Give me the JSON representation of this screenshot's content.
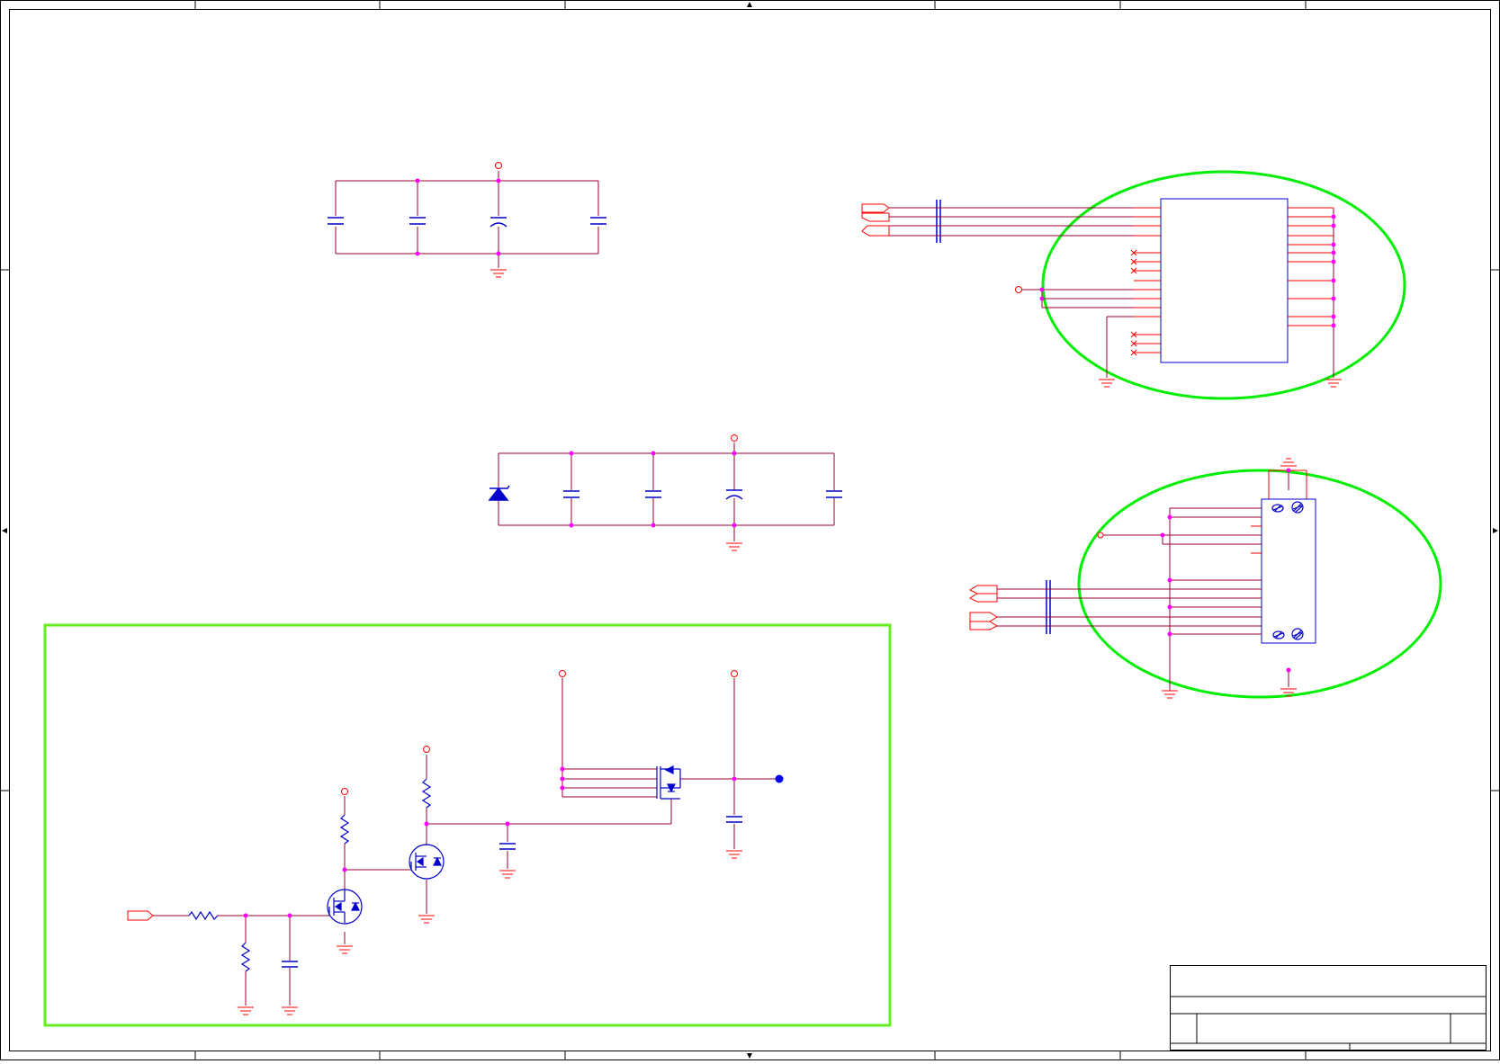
{
  "sheet": {
    "title": "",
    "colors": {
      "frame": "#000000",
      "wire": "#990033",
      "component": "#0000cc",
      "net_red": "#ff0000",
      "junction": "#ff00ff",
      "highlight": "#00ee00",
      "highlight_rect": "#66ee22"
    }
  },
  "title_block": {
    "title": "",
    "document_number": "",
    "revision": "",
    "sheet": ""
  },
  "blocks": {
    "decoupling_top": {
      "label": ""
    },
    "decoupling_mid": {
      "label": ""
    },
    "power_switch": {
      "label": ""
    },
    "connector_ic": {
      "label": ""
    },
    "usb_connector": {
      "label": ""
    }
  }
}
